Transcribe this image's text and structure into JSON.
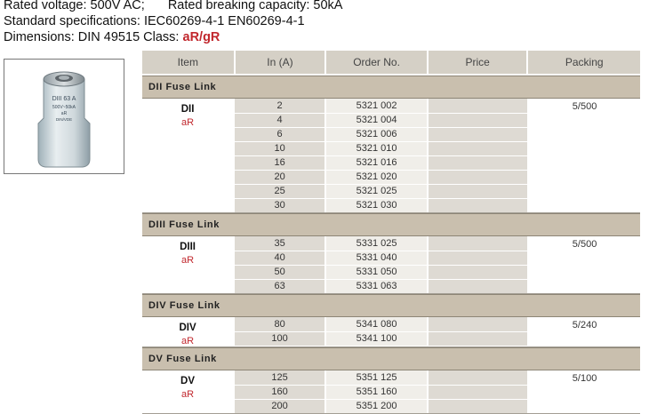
{
  "specs": {
    "partial_top_line": "Rated voltage heading cut",
    "rated_voltage": "Rated voltage: 500V AC;",
    "breaking_capacity": "Rated breaking capacity: 50kA",
    "standards": "Standard specifications: IEC60269-4-1 EN60269-4-1",
    "dimensions": "Dimensions: DIN 49515",
    "class_label": "Class:",
    "class_value": "aR/gR"
  },
  "photo": {
    "cap_text_1": "DIII 63 A",
    "cap_text_2": "500V~50kA",
    "cap_text_3": "aR",
    "cap_text_4": "DIN/VDE"
  },
  "table": {
    "headers": {
      "item": "Item",
      "in": "In (A)",
      "order": "Order No.",
      "price": "Price",
      "packing": "Packing"
    },
    "groups": [
      {
        "title": "DII Fuse Link",
        "name": "DII",
        "cls": "aR",
        "packing": "5/500",
        "rows": [
          {
            "in": "2",
            "order": "5321 002"
          },
          {
            "in": "4",
            "order": "5321 004"
          },
          {
            "in": "6",
            "order": "5321 006"
          },
          {
            "in": "10",
            "order": "5321 010"
          },
          {
            "in": "16",
            "order": "5321 016"
          },
          {
            "in": "20",
            "order": "5321 020"
          },
          {
            "in": "25",
            "order": "5321 025"
          },
          {
            "in": "30",
            "order": "5321 030"
          }
        ]
      },
      {
        "title": "DIII Fuse Link",
        "name": "DIII",
        "cls": "aR",
        "packing": "5/500",
        "rows": [
          {
            "in": "35",
            "order": "5331 025"
          },
          {
            "in": "40",
            "order": "5331 040"
          },
          {
            "in": "50",
            "order": "5331 050"
          },
          {
            "in": "63",
            "order": "5331 063"
          }
        ]
      },
      {
        "title": "DIV Fuse Link",
        "name": "DIV",
        "cls": "aR",
        "packing": "5/240",
        "rows": [
          {
            "in": "80",
            "order": "5341 080"
          },
          {
            "in": "100",
            "order": "5341 100"
          }
        ]
      },
      {
        "title": "DV Fuse Link",
        "name": "DV",
        "cls": "aR",
        "packing": "5/100",
        "rows": [
          {
            "in": "125",
            "order": "5351 125"
          },
          {
            "in": "160",
            "order": "5351 160"
          },
          {
            "in": "200",
            "order": "5351 200"
          }
        ]
      }
    ]
  }
}
